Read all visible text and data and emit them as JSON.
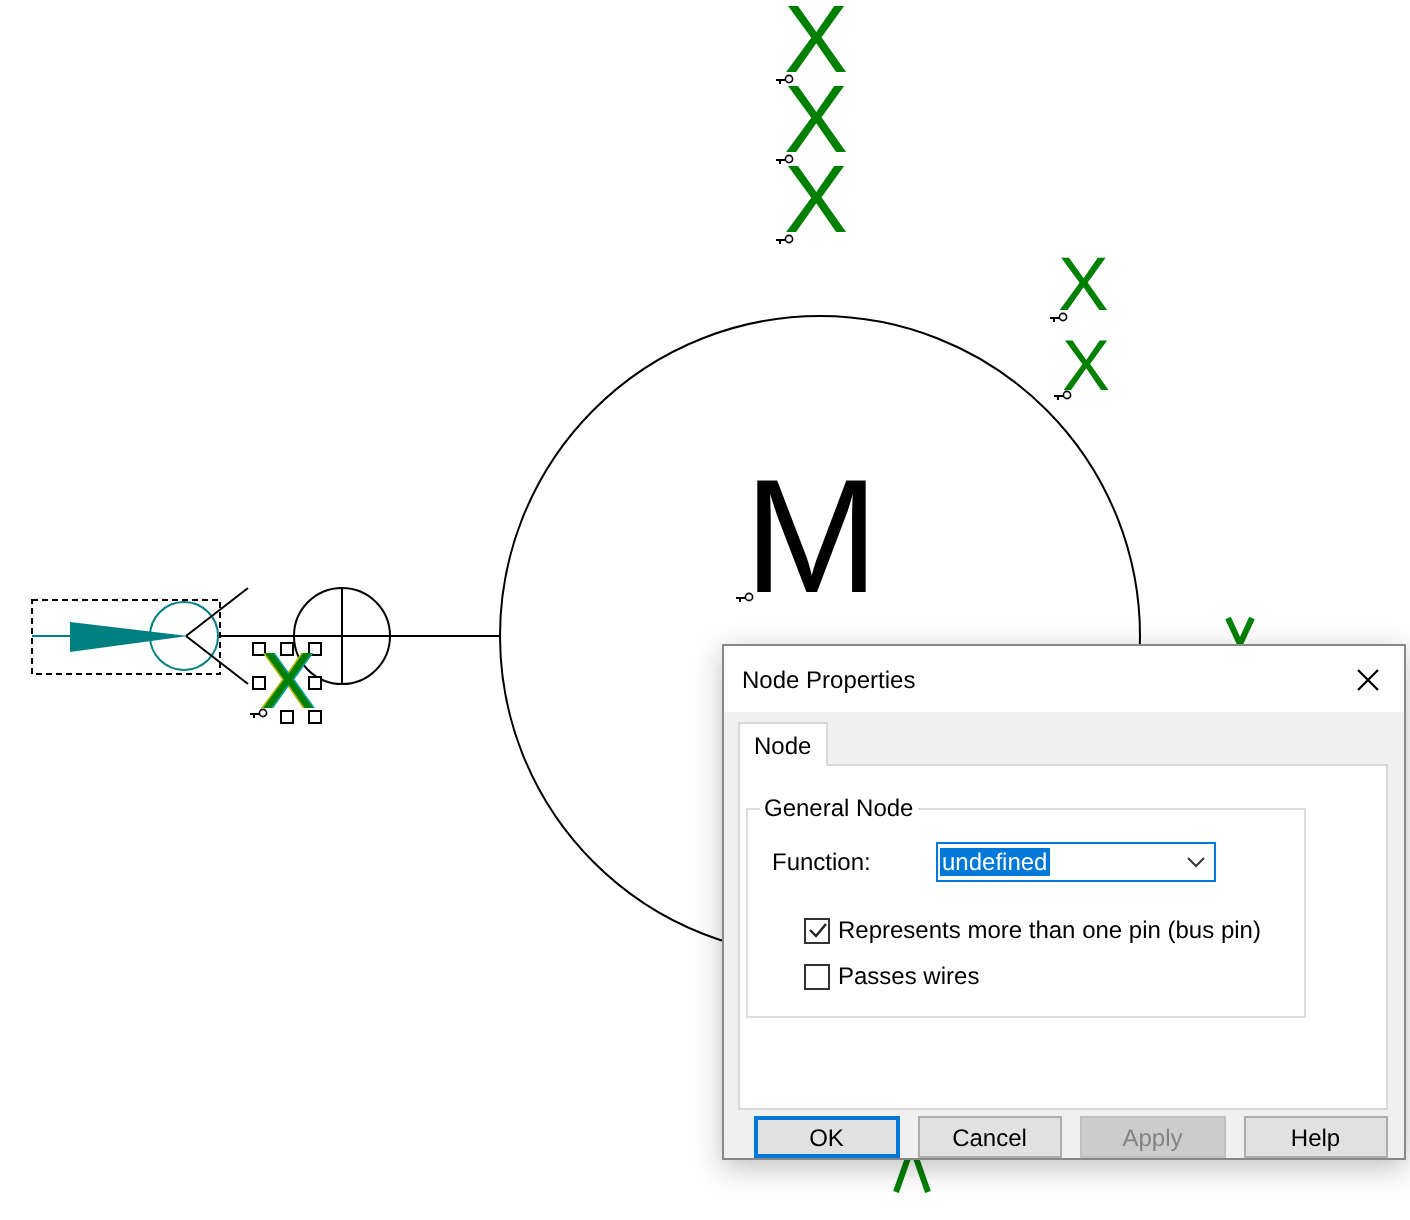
{
  "canvas": {
    "labels": [
      {
        "text": "X",
        "selected": false
      },
      {
        "text": "X",
        "selected": false
      },
      {
        "text": "X",
        "selected": false
      },
      {
        "text": "X",
        "selected": false
      },
      {
        "text": "X",
        "selected": false
      },
      {
        "text": "M",
        "selected": false
      },
      {
        "text": "X",
        "selected": true
      }
    ]
  },
  "dialog": {
    "title": "Node Properties",
    "tabs": [
      {
        "label": "Node",
        "selected": true
      }
    ],
    "group": {
      "title": "General Node",
      "function_label": "Function:",
      "function_value": "undefined",
      "checkboxes": [
        {
          "label": "Represents more than one pin (bus pin)",
          "checked": true
        },
        {
          "label": "Passes wires",
          "checked": false
        }
      ]
    },
    "buttons": [
      {
        "label": "OK",
        "default": true,
        "disabled": false
      },
      {
        "label": "Cancel",
        "default": false,
        "disabled": false
      },
      {
        "label": "Apply",
        "default": false,
        "disabled": true
      },
      {
        "label": "Help",
        "default": false,
        "disabled": false
      }
    ]
  }
}
